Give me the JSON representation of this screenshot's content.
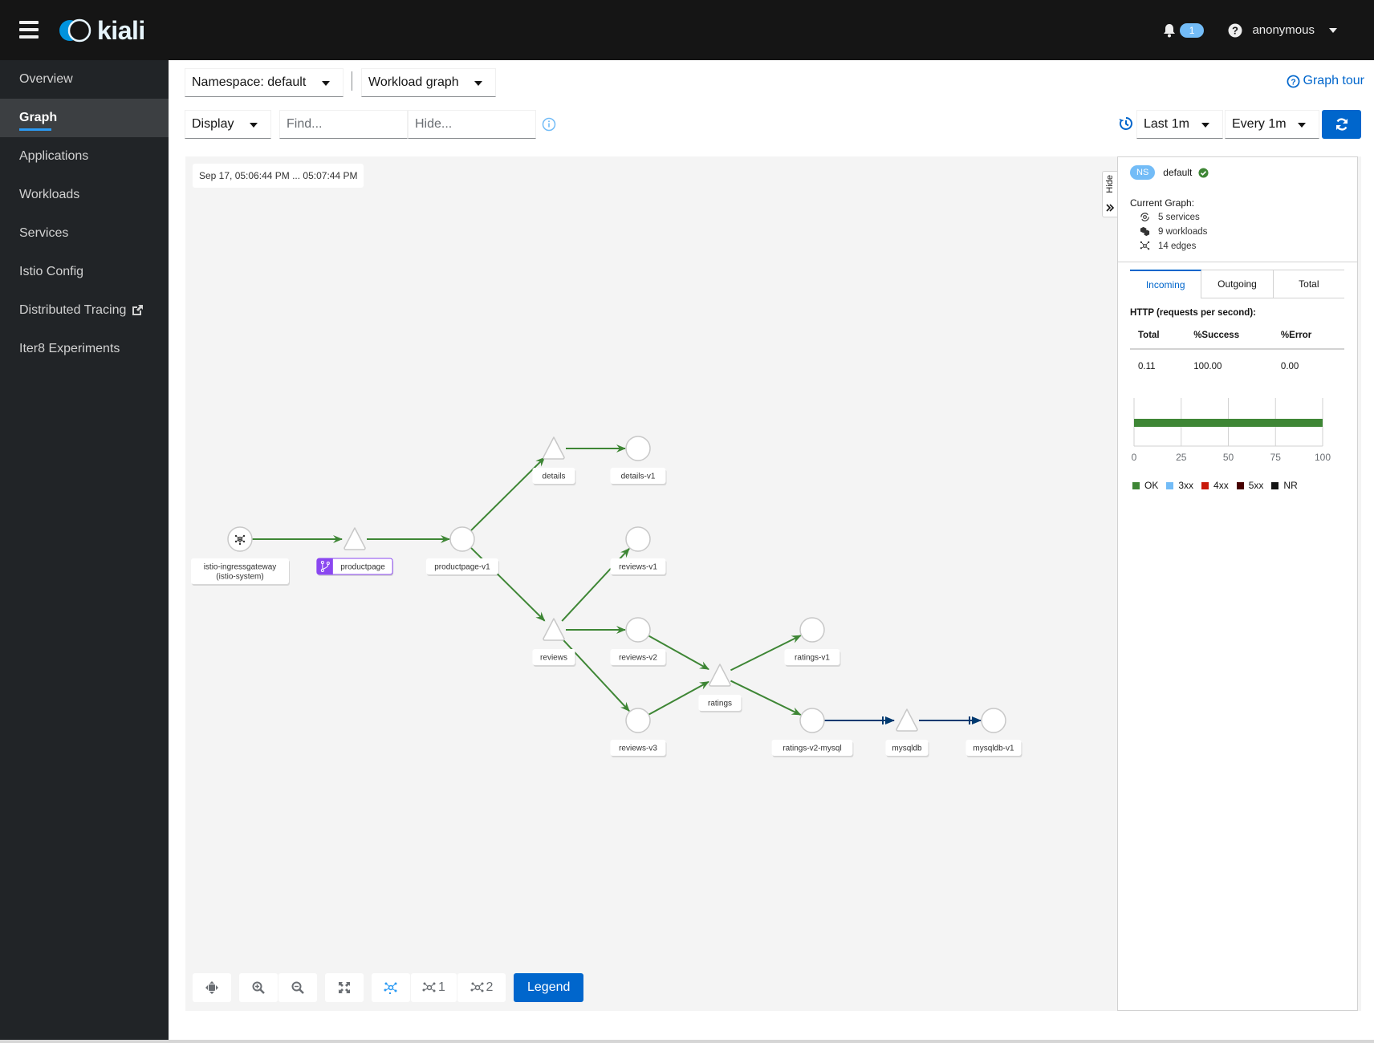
{
  "masthead": {
    "app_name": "kiali",
    "notification_count": "1",
    "user": "anonymous"
  },
  "sidebar": {
    "items": [
      {
        "label": "Overview",
        "active": false
      },
      {
        "label": "Graph",
        "active": true
      },
      {
        "label": "Applications",
        "active": false
      },
      {
        "label": "Workloads",
        "active": false
      },
      {
        "label": "Services",
        "active": false
      },
      {
        "label": "Istio Config",
        "active": false
      },
      {
        "label": "Distributed Tracing",
        "active": false,
        "external": true
      },
      {
        "label": "Iter8 Experiments",
        "active": false
      }
    ]
  },
  "toolbar": {
    "namespace_select": "Namespace: default",
    "graph_type_select": "Workload graph",
    "display_select": "Display",
    "find_placeholder": "Find...",
    "hide_placeholder": "Hide...",
    "graph_tour": "Graph tour",
    "duration_select": "Last 1m",
    "refresh_select": "Every 1m"
  },
  "graph": {
    "timestamp": "Sep 17, 05:06:44 PM ... 05:07:44 PM",
    "nodes": [
      {
        "id": "istio-ingressgateway",
        "label": "istio-ingressgateway",
        "sublabel": "(istio-system)",
        "shape": "circle",
        "icon": "gateway"
      },
      {
        "id": "productpage",
        "label": "productpage",
        "shape": "triangle",
        "badge": "virtual-service"
      },
      {
        "id": "productpage-v1",
        "label": "productpage-v1",
        "shape": "circle"
      },
      {
        "id": "details",
        "label": "details",
        "shape": "triangle"
      },
      {
        "id": "details-v1",
        "label": "details-v1",
        "shape": "circle"
      },
      {
        "id": "reviews",
        "label": "reviews",
        "shape": "triangle"
      },
      {
        "id": "reviews-v1",
        "label": "reviews-v1",
        "shape": "circle"
      },
      {
        "id": "reviews-v2",
        "label": "reviews-v2",
        "shape": "circle"
      },
      {
        "id": "reviews-v3",
        "label": "reviews-v3",
        "shape": "circle"
      },
      {
        "id": "ratings",
        "label": "ratings",
        "shape": "triangle"
      },
      {
        "id": "ratings-v1",
        "label": "ratings-v1",
        "shape": "circle"
      },
      {
        "id": "ratings-v2-mysql",
        "label": "ratings-v2-mysql",
        "shape": "circle"
      },
      {
        "id": "mysqldb",
        "label": "mysqldb",
        "shape": "triangle"
      },
      {
        "id": "mysqldb-v1",
        "label": "mysqldb-v1",
        "shape": "circle"
      }
    ],
    "edges": [
      {
        "from": "istio-ingressgateway",
        "to": "productpage",
        "protocol": "http"
      },
      {
        "from": "productpage",
        "to": "productpage-v1",
        "protocol": "http"
      },
      {
        "from": "productpage-v1",
        "to": "details",
        "protocol": "http"
      },
      {
        "from": "details",
        "to": "details-v1",
        "protocol": "http"
      },
      {
        "from": "productpage-v1",
        "to": "reviews",
        "protocol": "http"
      },
      {
        "from": "reviews",
        "to": "reviews-v1",
        "protocol": "http"
      },
      {
        "from": "reviews",
        "to": "reviews-v2",
        "protocol": "http"
      },
      {
        "from": "reviews",
        "to": "reviews-v3",
        "protocol": "http"
      },
      {
        "from": "reviews-v2",
        "to": "ratings",
        "protocol": "http"
      },
      {
        "from": "reviews-v3",
        "to": "ratings",
        "protocol": "http"
      },
      {
        "from": "ratings",
        "to": "ratings-v1",
        "protocol": "http"
      },
      {
        "from": "ratings",
        "to": "ratings-v2-mysql",
        "protocol": "http"
      },
      {
        "from": "ratings-v2-mysql",
        "to": "mysqldb",
        "protocol": "tcp"
      },
      {
        "from": "mysqldb",
        "to": "mysqldb-v1",
        "protocol": "tcp"
      }
    ],
    "colors": {
      "http_ok": "#3e8635",
      "tcp": "#003a70",
      "badge": "#8a47f0"
    }
  },
  "graph_toolbar": {
    "layout_default_label": "",
    "layout_1_label": "1",
    "layout_2_label": "2",
    "legend_label": "Legend"
  },
  "side_panel": {
    "hide_label": "Hide",
    "ns_badge": "NS",
    "namespace": "default",
    "current_graph_title": "Current Graph:",
    "services": "5 services",
    "workloads": "9 workloads",
    "edges": "14 edges",
    "tabs": [
      {
        "label": "Incoming",
        "active": true
      },
      {
        "label": "Outgoing",
        "active": false
      },
      {
        "label": "Total",
        "active": false
      }
    ],
    "http_title": "HTTP (requests per second):",
    "table": {
      "headers": [
        "Total",
        "%Success",
        "%Error"
      ],
      "row": [
        "0.11",
        "100.00",
        "0.00"
      ]
    },
    "chart_data": {
      "type": "bar",
      "orientation": "horizontal",
      "stacked": true,
      "categories": [
        ""
      ],
      "series": [
        {
          "name": "OK",
          "values": [
            100
          ],
          "color": "#3e8635"
        },
        {
          "name": "3xx",
          "values": [
            0
          ],
          "color": "#73bcf7"
        },
        {
          "name": "4xx",
          "values": [
            0
          ],
          "color": "#c9190b"
        },
        {
          "name": "5xx",
          "values": [
            0
          ],
          "color": "#470000"
        },
        {
          "name": "NR",
          "values": [
            0
          ],
          "color": "#151515"
        }
      ],
      "xlim": [
        0,
        100
      ],
      "xticks": [
        "0",
        "25",
        "50",
        "75",
        "100"
      ],
      "grid": true,
      "legend": "bottom"
    }
  }
}
